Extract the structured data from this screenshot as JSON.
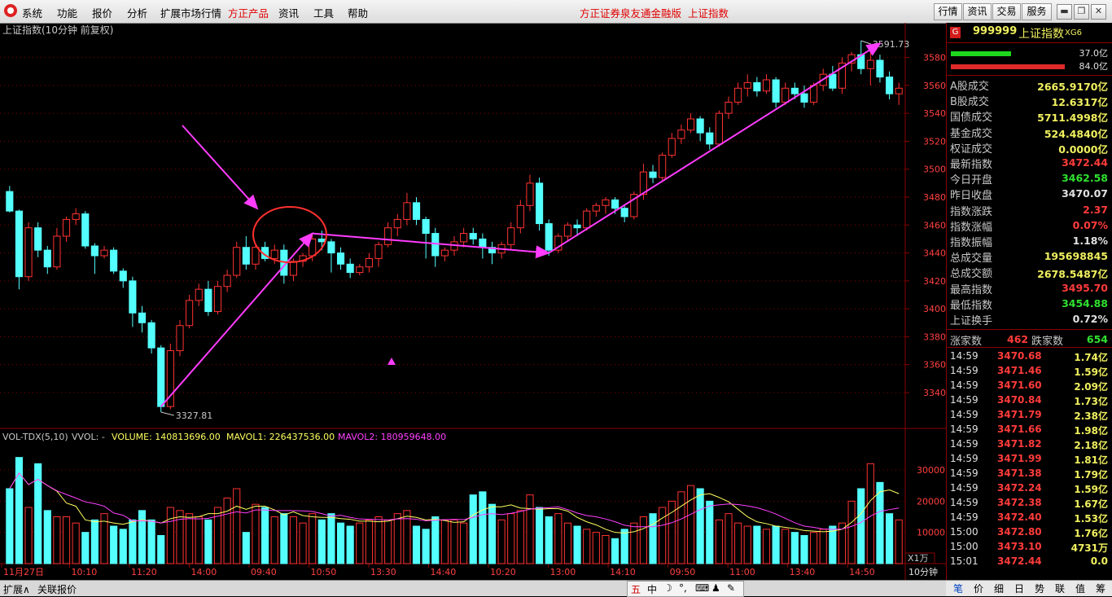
{
  "menu": {
    "items": [
      "系统",
      "功能",
      "报价",
      "分析",
      "扩展市场行情",
      "方正产品",
      "资讯",
      "工具",
      "帮助"
    ],
    "center_text": "方正证券泉友通金融版",
    "center_text2": "上证指数",
    "right_buttons": [
      "行情",
      "资讯",
      "交易",
      "服务"
    ]
  },
  "chart": {
    "title": "上证指数(10分钟 前复权)",
    "high_label": "3591.73",
    "low_label": "3327.81",
    "y_ticks": [
      "3580",
      "3560",
      "3540",
      "3520",
      "3500",
      "3480",
      "3460",
      "3440",
      "3420",
      "3400",
      "3380",
      "3360",
      "3340"
    ],
    "vol_header": {
      "name": "VOL-TDX(5,10)",
      "vvol": "VVOL: -",
      "volume": "VOLUME: 140813696.00",
      "mavol1": "MAVOL1: 226437536.00",
      "mavol2": "MAVOL2: 180959648.00"
    },
    "vol_y_ticks": [
      "30000",
      "20000",
      "10000"
    ],
    "vol_unit": "X1万",
    "x_ticks": [
      "11月27日",
      "10:10",
      "11:20",
      "14:00",
      "09:40",
      "10:50",
      "13:30",
      "14:40",
      "10:20",
      "13:00",
      "14:10",
      "09:50",
      "11:00",
      "13:40",
      "14:50"
    ],
    "period": "10分钟",
    "colors": {
      "up": "#ff3232",
      "down": "#54ffff",
      "ma1": "#ffff60",
      "ma2": "#ff40ff",
      "grid": "#8a0000",
      "annotation": "#ff3cff",
      "circle": "#ff3030"
    }
  },
  "chart_data": {
    "type": "candlestick",
    "ohlc": [
      [
        3484,
        3488,
        3469,
        3470
      ],
      [
        3470,
        3471,
        3414,
        3423
      ],
      [
        3423,
        3462,
        3420,
        3458
      ],
      [
        3458,
        3462,
        3437,
        3442
      ],
      [
        3442,
        3445,
        3425,
        3430
      ],
      [
        3430,
        3458,
        3428,
        3452
      ],
      [
        3452,
        3466,
        3448,
        3464
      ],
      [
        3464,
        3472,
        3460,
        3468
      ],
      [
        3468,
        3470,
        3443,
        3445
      ],
      [
        3445,
        3447,
        3425,
        3438
      ],
      [
        3438,
        3445,
        3436,
        3442
      ],
      [
        3442,
        3444,
        3425,
        3427
      ],
      [
        3427,
        3429,
        3415,
        3420
      ],
      [
        3420,
        3423,
        3387,
        3397
      ],
      [
        3397,
        3402,
        3383,
        3390
      ],
      [
        3390,
        3392,
        3368,
        3372
      ],
      [
        3372,
        3374,
        3326,
        3330
      ],
      [
        3330,
        3375,
        3328,
        3370
      ],
      [
        3370,
        3392,
        3366,
        3388
      ],
      [
        3388,
        3410,
        3386,
        3406
      ],
      [
        3406,
        3418,
        3402,
        3414
      ],
      [
        3414,
        3420,
        3395,
        3398
      ],
      [
        3398,
        3420,
        3396,
        3416
      ],
      [
        3416,
        3428,
        3412,
        3424
      ],
      [
        3424,
        3448,
        3422,
        3444
      ],
      [
        3444,
        3452,
        3428,
        3432
      ],
      [
        3432,
        3446,
        3428,
        3444
      ],
      [
        3444,
        3448,
        3434,
        3436
      ],
      [
        3436,
        3446,
        3432,
        3442
      ],
      [
        3442,
        3446,
        3418,
        3424
      ],
      [
        3424,
        3436,
        3420,
        3434
      ],
      [
        3434,
        3440,
        3430,
        3438
      ],
      [
        3438,
        3454,
        3434,
        3450
      ],
      [
        3450,
        3456,
        3442,
        3448
      ],
      [
        3448,
        3450,
        3426,
        3440
      ],
      [
        3440,
        3444,
        3428,
        3432
      ],
      [
        3432,
        3436,
        3422,
        3426
      ],
      [
        3426,
        3432,
        3424,
        3430
      ],
      [
        3430,
        3440,
        3426,
        3436
      ],
      [
        3436,
        3448,
        3430,
        3446
      ],
      [
        3446,
        3462,
        3444,
        3458
      ],
      [
        3458,
        3468,
        3452,
        3464
      ],
      [
        3464,
        3483,
        3460,
        3476
      ],
      [
        3476,
        3480,
        3460,
        3464
      ],
      [
        3464,
        3466,
        3436,
        3454
      ],
      [
        3454,
        3458,
        3430,
        3438
      ],
      [
        3438,
        3444,
        3434,
        3442
      ],
      [
        3442,
        3452,
        3438,
        3448
      ],
      [
        3448,
        3458,
        3444,
        3454
      ],
      [
        3454,
        3458,
        3446,
        3450
      ],
      [
        3450,
        3454,
        3436,
        3444
      ],
      [
        3444,
        3448,
        3432,
        3440
      ],
      [
        3440,
        3448,
        3436,
        3446
      ],
      [
        3446,
        3462,
        3442,
        3458
      ],
      [
        3458,
        3478,
        3454,
        3474
      ],
      [
        3474,
        3496,
        3470,
        3490
      ],
      [
        3490,
        3494,
        3456,
        3461
      ],
      [
        3461,
        3464,
        3438,
        3442
      ],
      [
        3442,
        3454,
        3440,
        3452
      ],
      [
        3452,
        3462,
        3448,
        3460
      ],
      [
        3460,
        3464,
        3452,
        3458
      ],
      [
        3458,
        3472,
        3456,
        3470
      ],
      [
        3470,
        3476,
        3466,
        3474
      ],
      [
        3474,
        3480,
        3468,
        3478
      ],
      [
        3478,
        3480,
        3468,
        3472
      ],
      [
        3472,
        3474,
        3462,
        3466
      ],
      [
        3466,
        3484,
        3464,
        3482
      ],
      [
        3482,
        3504,
        3478,
        3498
      ],
      [
        3498,
        3503,
        3490,
        3494
      ],
      [
        3494,
        3512,
        3492,
        3510
      ],
      [
        3510,
        3526,
        3508,
        3522
      ],
      [
        3522,
        3532,
        3518,
        3528
      ],
      [
        3528,
        3540,
        3526,
        3536
      ],
      [
        3536,
        3538,
        3520,
        3526
      ],
      [
        3526,
        3530,
        3514,
        3518
      ],
      [
        3518,
        3542,
        3516,
        3540
      ],
      [
        3540,
        3552,
        3536,
        3548
      ],
      [
        3548,
        3562,
        3546,
        3558
      ],
      [
        3558,
        3568,
        3552,
        3562
      ],
      [
        3562,
        3566,
        3552,
        3556
      ],
      [
        3556,
        3568,
        3554,
        3564
      ],
      [
        3564,
        3566,
        3544,
        3548
      ],
      [
        3548,
        3562,
        3546,
        3558
      ],
      [
        3558,
        3562,
        3550,
        3554
      ],
      [
        3554,
        3560,
        3544,
        3548
      ],
      [
        3548,
        3562,
        3546,
        3560
      ],
      [
        3560,
        3572,
        3556,
        3568
      ],
      [
        3568,
        3574,
        3556,
        3558
      ],
      [
        3558,
        3580,
        3554,
        3576
      ],
      [
        3576,
        3584,
        3570,
        3582
      ],
      [
        3582,
        3592,
        3568,
        3572
      ],
      [
        3572,
        3584,
        3560,
        3578
      ],
      [
        3578,
        3582,
        3562,
        3566
      ],
      [
        3566,
        3570,
        3550,
        3554
      ],
      [
        3554,
        3562,
        3546,
        3558
      ]
    ],
    "volume": [
      24,
      34,
      18,
      32,
      17,
      15,
      15,
      13,
      10,
      14,
      16,
      12,
      11,
      14,
      17,
      14,
      9,
      18,
      17,
      16,
      15,
      14,
      18,
      21,
      24,
      10,
      19,
      18,
      15,
      16,
      15,
      13,
      16,
      14,
      16,
      13,
      12,
      13,
      14,
      15,
      14,
      16,
      17,
      12,
      11,
      15,
      14,
      14,
      13,
      22,
      23,
      19,
      14,
      16,
      17,
      22,
      18,
      15,
      16,
      13,
      12,
      11,
      10,
      9,
      8,
      11,
      13,
      15,
      16,
      18,
      20,
      23,
      25,
      24,
      20,
      14,
      16,
      13,
      12,
      12,
      11,
      12,
      11,
      10,
      9,
      10,
      11,
      12,
      13,
      20,
      24,
      32,
      26,
      16,
      14
    ],
    "y_range": [
      3326,
      3592
    ]
  },
  "stock": {
    "badge": "G",
    "code": "999999",
    "name": "上证指数",
    "suffix": "XG6",
    "bar1_value": "37.0亿",
    "bar2_value": "84.0亿",
    "stats": [
      {
        "label": "A股成交",
        "value": "2665.9170亿",
        "color": "yel"
      },
      {
        "label": "B股成交",
        "value": "12.6317亿",
        "color": "yel"
      },
      {
        "label": "国债成交",
        "value": "5711.4998亿",
        "color": "yel"
      },
      {
        "label": "基金成交",
        "value": "524.4840亿",
        "color": "yel"
      },
      {
        "label": "权证成交",
        "value": "0.0000亿",
        "color": "yel"
      },
      {
        "label": "最新指数",
        "value": "3472.44",
        "color": "red"
      },
      {
        "label": "今日开盘",
        "value": "3462.58",
        "color": "grn"
      },
      {
        "label": "昨日收盘",
        "value": "3470.07",
        "color": "wht"
      },
      {
        "label": "指数涨跌",
        "value": "2.37",
        "color": "red"
      },
      {
        "label": "指数涨幅",
        "value": "0.07%",
        "color": "red"
      },
      {
        "label": "指数振幅",
        "value": "1.18%",
        "color": "wht"
      },
      {
        "label": "总成交量",
        "value": "195698845",
        "color": "yel"
      },
      {
        "label": "总成交额",
        "value": "2678.5487亿",
        "color": "yel"
      },
      {
        "label": "最高指数",
        "value": "3495.70",
        "color": "red"
      },
      {
        "label": "最低指数",
        "value": "3454.88",
        "color": "grn"
      },
      {
        "label": "上证换手",
        "value": "0.72%",
        "color": "wht"
      }
    ],
    "up_label": "涨家数",
    "up_count": "462",
    "down_label": "跌家数",
    "down_count": "654",
    "ticks": [
      {
        "time": "14:59",
        "price": "3470.68",
        "vol": "1.74亿"
      },
      {
        "time": "14:59",
        "price": "3471.46",
        "vol": "1.59亿"
      },
      {
        "time": "14:59",
        "price": "3471.60",
        "vol": "2.09亿"
      },
      {
        "time": "14:59",
        "price": "3470.84",
        "vol": "1.73亿"
      },
      {
        "time": "14:59",
        "price": "3471.79",
        "vol": "2.38亿"
      },
      {
        "time": "14:59",
        "price": "3471.66",
        "vol": "1.98亿"
      },
      {
        "time": "14:59",
        "price": "3471.82",
        "vol": "2.18亿"
      },
      {
        "time": "14:59",
        "price": "3471.99",
        "vol": "1.81亿"
      },
      {
        "time": "14:59",
        "price": "3471.38",
        "vol": "1.79亿"
      },
      {
        "time": "14:59",
        "price": "3472.24",
        "vol": "1.59亿"
      },
      {
        "time": "14:59",
        "price": "3472.38",
        "vol": "1.67亿"
      },
      {
        "time": "14:59",
        "price": "3472.40",
        "vol": "1.53亿"
      },
      {
        "time": "15:00",
        "price": "3472.80",
        "vol": "1.76亿"
      },
      {
        "time": "15:00",
        "price": "3473.10",
        "vol": "4731万"
      },
      {
        "time": "15:01",
        "price": "3472.44",
        "vol": "0.0"
      }
    ]
  },
  "status": {
    "left1": "扩展∧",
    "left2": "关联报价",
    "tools": [
      "五",
      "中",
      "☽",
      "°,",
      "⌨",
      "♟",
      "✎"
    ],
    "tabs": [
      "笔",
      "价",
      "细",
      "日",
      "势",
      "联",
      "值",
      "筹"
    ]
  }
}
